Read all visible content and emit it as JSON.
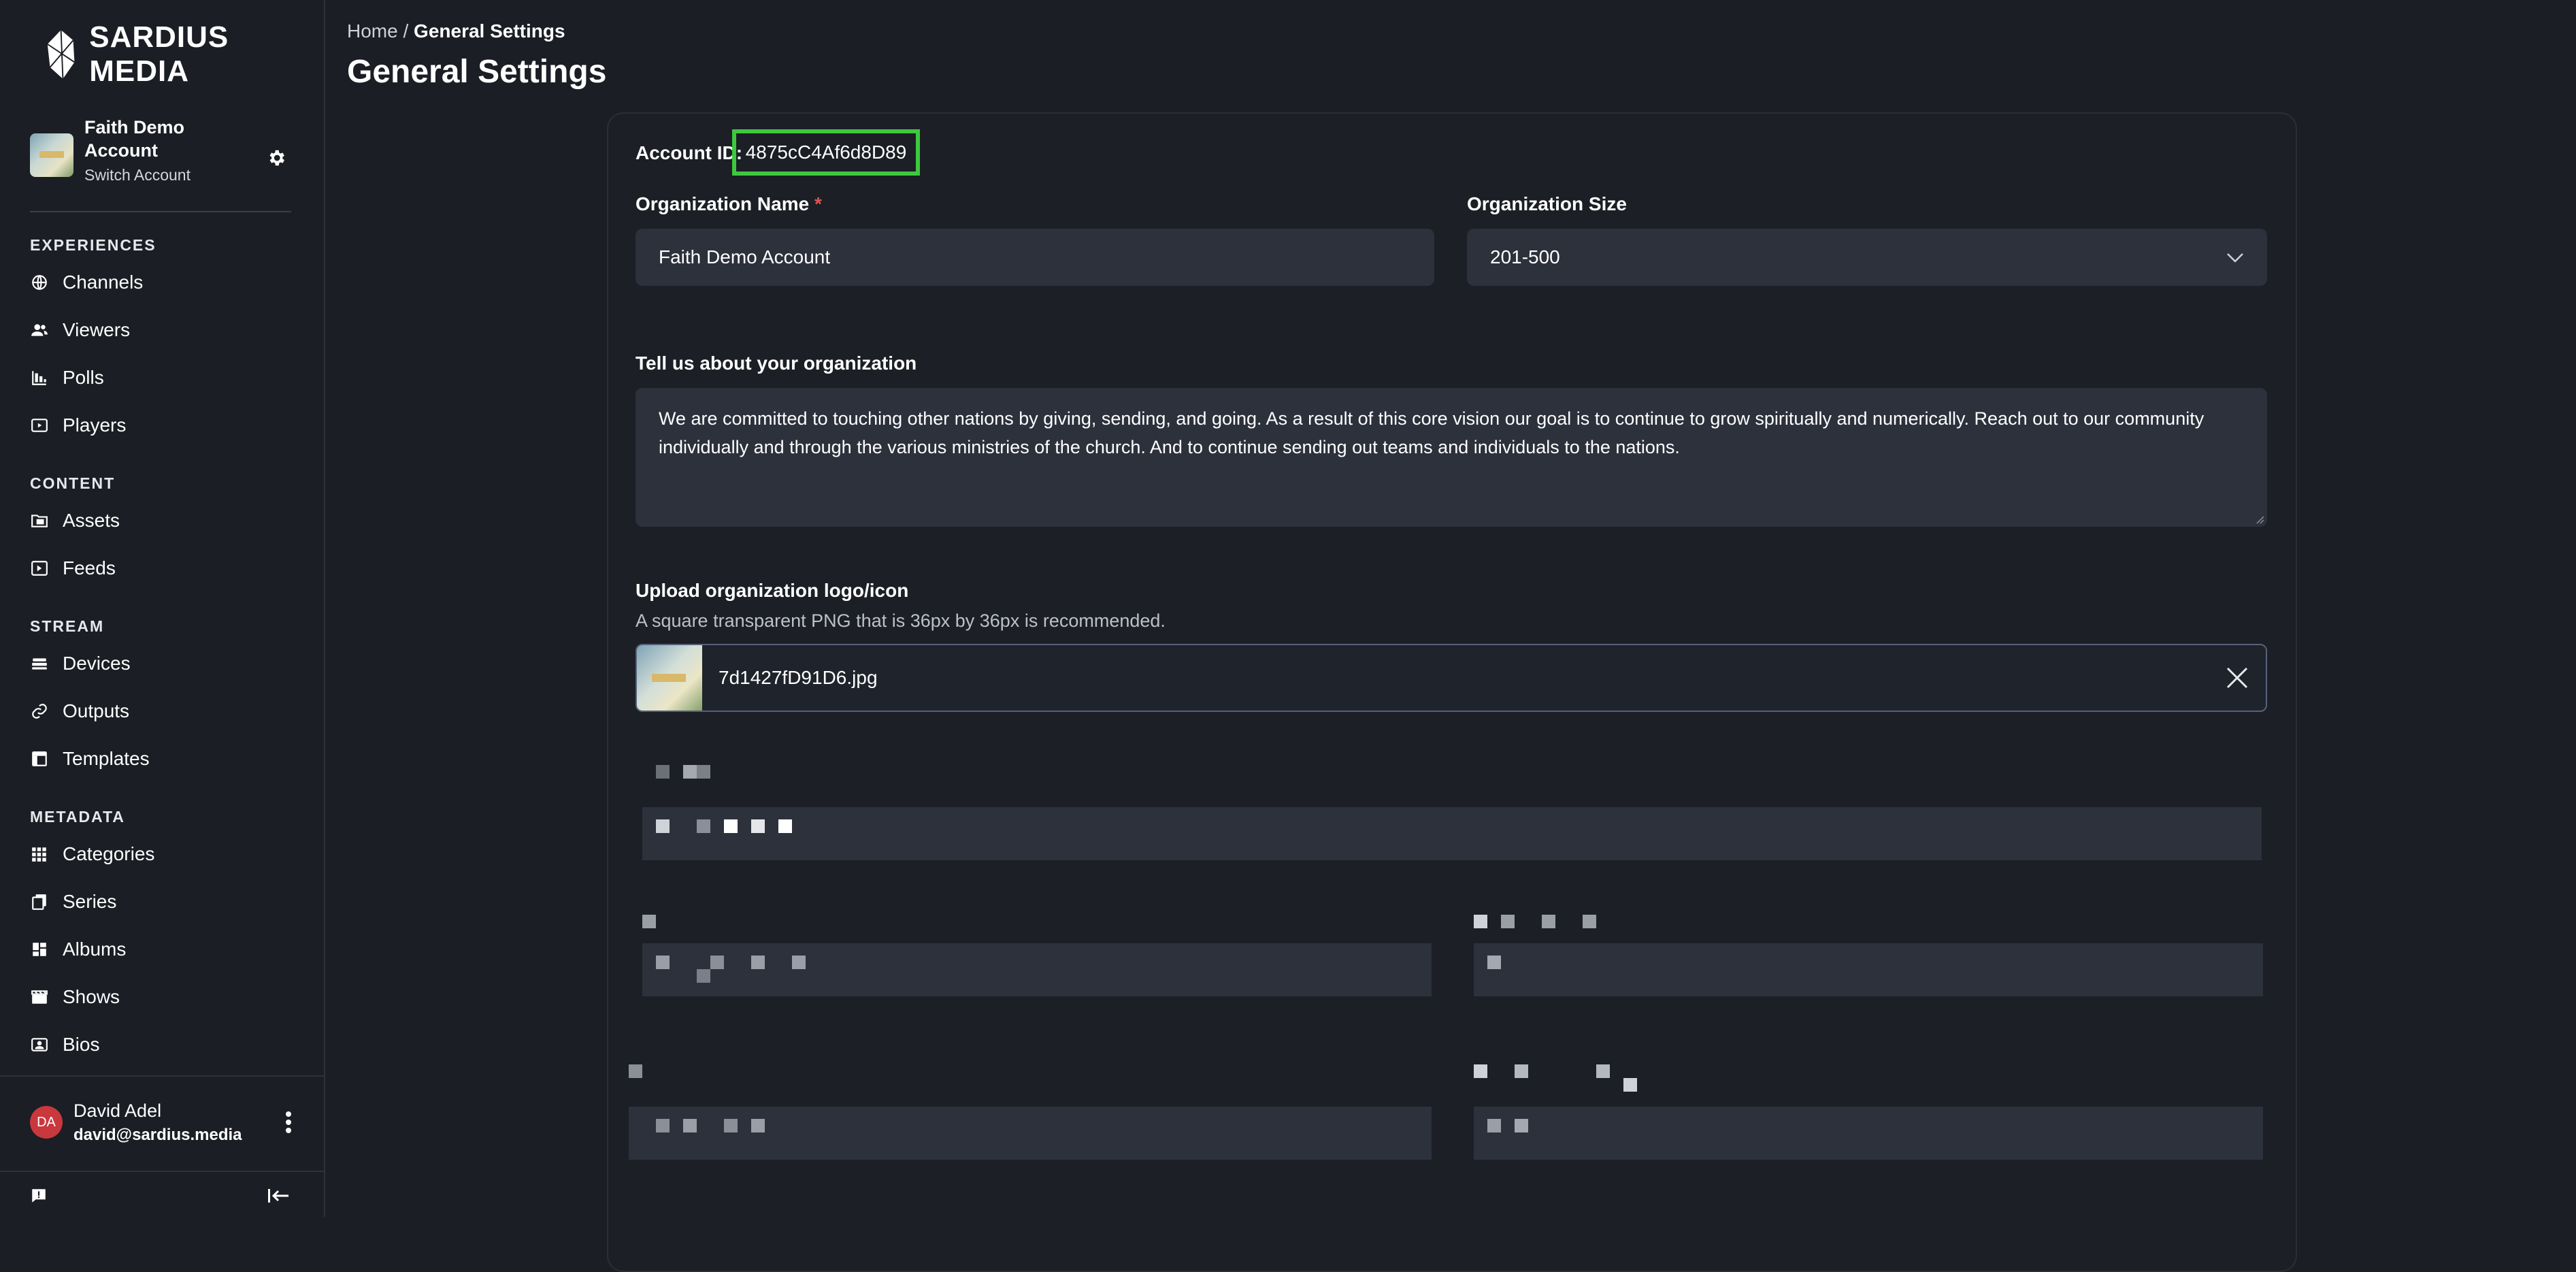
{
  "brand": {
    "name": "SARDIUS MEDIA",
    "mark": "®"
  },
  "account": {
    "name": "Faith Demo Account",
    "switch_label": "Switch Account"
  },
  "nav": {
    "sections": [
      {
        "title": "EXPERIENCES",
        "items": [
          {
            "label": "Channels",
            "icon": "globe-icon"
          },
          {
            "label": "Viewers",
            "icon": "users-icon"
          },
          {
            "label": "Polls",
            "icon": "bar-chart-icon"
          },
          {
            "label": "Players",
            "icon": "play-square-icon"
          }
        ]
      },
      {
        "title": "CONTENT",
        "items": [
          {
            "label": "Assets",
            "icon": "folder-media-icon"
          },
          {
            "label": "Feeds",
            "icon": "feed-icon"
          }
        ]
      },
      {
        "title": "STREAM",
        "items": [
          {
            "label": "Devices",
            "icon": "device-stack-icon"
          },
          {
            "label": "Outputs",
            "icon": "link-icon"
          },
          {
            "label": "Templates",
            "icon": "template-icon"
          }
        ]
      },
      {
        "title": "METADATA",
        "items": [
          {
            "label": "Categories",
            "icon": "grid-icon"
          },
          {
            "label": "Series",
            "icon": "copy-icon"
          },
          {
            "label": "Albums",
            "icon": "dashboard-icon"
          },
          {
            "label": "Shows",
            "icon": "clapper-icon"
          },
          {
            "label": "Bios",
            "icon": "contact-icon"
          }
        ]
      }
    ]
  },
  "user": {
    "initials": "DA",
    "name": "David Adel",
    "email": "david@sardius.media"
  },
  "breadcrumb": {
    "home": "Home",
    "separator": "/",
    "current": "General Settings"
  },
  "page_title": "General Settings",
  "form": {
    "account_id_label": "Account ID:",
    "account_id_value": "4875cC4Af6d8D89",
    "org_name_label": "Organization Name",
    "required_mark": "*",
    "org_name_value": "Faith Demo Account",
    "org_size_label": "Organization Size",
    "org_size_value": "201-500",
    "about_label": "Tell us about your organization",
    "about_value": "We are committed to touching other nations by giving, sending, and going. As a result of this core vision our goal is to continue to grow spiritually and numerically.  Reach out to our community individually and through the various ministries of the church.  And to continue sending out teams and individuals to the nations.",
    "upload_label": "Upload organization logo/icon",
    "upload_hint": "A square transparent PNG that is 36px by 36px is recommended.",
    "upload_filename": "7d1427fD91D6.jpg"
  },
  "colors": {
    "accent_highlight": "#3ec83f",
    "required": "#e05353",
    "avatar": "#c8383d",
    "field_bg": "#2c313c",
    "page_bg": "#1b1e24"
  }
}
